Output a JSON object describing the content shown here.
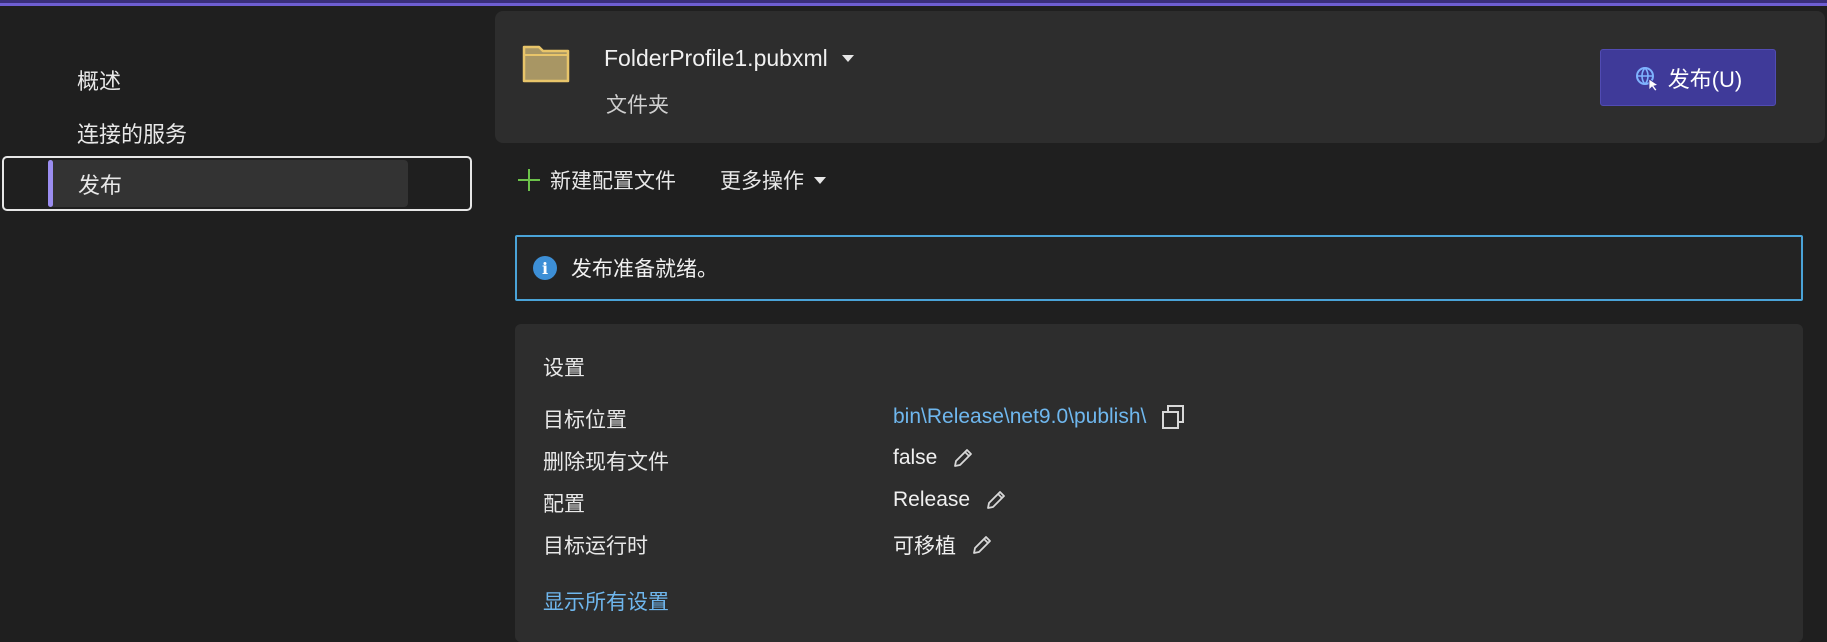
{
  "sidebar": {
    "items": [
      {
        "label": "概述"
      },
      {
        "label": "连接的服务"
      },
      {
        "label": "发布"
      }
    ]
  },
  "profile": {
    "name": "FolderProfile1.pubxml",
    "type": "文件夹",
    "publish_button": "发布(U)"
  },
  "toolbar": {
    "new_profile": "新建配置文件",
    "more_actions": "更多操作"
  },
  "banner": {
    "message": "发布准备就绪。"
  },
  "settings": {
    "title": "设置",
    "rows": [
      {
        "label": "目标位置",
        "value": "bin\\Release\\net9.0\\publish\\"
      },
      {
        "label": "删除现有文件",
        "value": "false"
      },
      {
        "label": "配置",
        "value": "Release"
      },
      {
        "label": "目标运行时",
        "value": "可移植"
      }
    ],
    "show_all": "显示所有设置"
  },
  "colors": {
    "accent": "#6e5ed2",
    "publish_button_bg": "#3f3a99",
    "info_border": "#4aa3d8",
    "link": "#6fb7ee",
    "plus_green": "#6cc24a",
    "folder_fill": "#a89664",
    "folder_stroke": "#e8c56a"
  },
  "icons": {
    "profile": "folder-icon",
    "publish": "globe-publish-icon",
    "new_profile": "plus-icon",
    "more_actions": "caret-down-icon",
    "banner": "info-icon",
    "copy": "copy-icon",
    "edit": "pencil-icon"
  }
}
